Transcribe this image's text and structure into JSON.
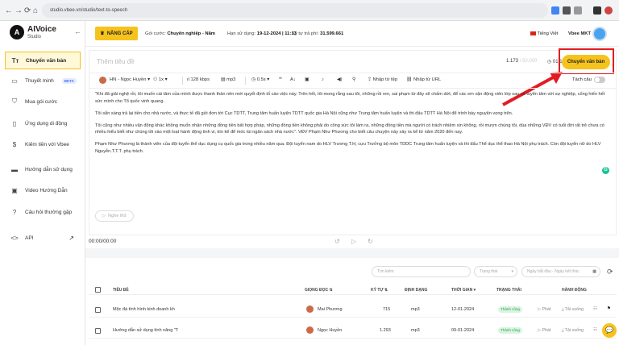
{
  "browser": {
    "url": "studio.vbee.vn/studio/text-to-speech",
    "nav": [
      "←",
      "→",
      "⟳",
      "⌂"
    ]
  },
  "brand": {
    "name": "AIVoice",
    "sub": "Studio",
    "logo_letter": "A"
  },
  "sidebar": {
    "items": [
      {
        "label": "Chuyển văn bản",
        "icon": "text-icon",
        "glyph": "Tт",
        "active": true
      },
      {
        "label": "Thuyết minh",
        "icon": "video-icon",
        "glyph": "▭",
        "beta": "BETA"
      },
      {
        "label": "Mua gói cước",
        "icon": "cart-icon",
        "glyph": "⛉"
      },
      {
        "label": "Ứng dụng di động",
        "icon": "phone-icon",
        "glyph": "▯"
      },
      {
        "label": "Kiếm tiền với Vbee",
        "icon": "dollar-icon",
        "glyph": "$"
      },
      {
        "label": "Hướng dẫn sử dụng",
        "icon": "folder-icon",
        "glyph": "▬"
      },
      {
        "label": "Video Hướng Dẫn",
        "icon": "video-guide-icon",
        "glyph": "▣"
      },
      {
        "label": "Câu hỏi thường gặp",
        "icon": "help-icon",
        "glyph": "?"
      },
      {
        "label": "API",
        "icon": "code-icon",
        "glyph": "<>",
        "external": "↗"
      }
    ]
  },
  "topbar": {
    "upgrade": "NÂNG CẤP",
    "plan_label": "Gói cước:",
    "plan_value": "Chuyên nghiệp - Năm",
    "expiry_label": "Hạn sử dụng:",
    "expiry_value": "19-12-2024 | 11:13",
    "chars_label": "Ký tự trả phí:",
    "chars_value": "31.599.661",
    "language": "Tiếng Việt",
    "user": "Vbee MKT"
  },
  "editor": {
    "title_placeholder": "Thêm tiêu đề",
    "count_used": "1.173",
    "count_max": "/ 50.000",
    "duration": "01:10",
    "convert_button": "Chuyển văn bản",
    "toolbar": {
      "voice": "HN - Ngọc Huyền",
      "speed": "1x",
      "bitrate": "128 kbps",
      "format": "mp3",
      "pause": "0.5s",
      "import_file": "Nhập từ tệp",
      "import_url": "Nhập từ URL",
      "split": "Tách câu"
    },
    "paragraphs": [
      "\"Khi đã giải nghệ rồi, tôi muốn cái tâm của mình được thanh thản nên mới quyết định tố cáo việc này. Trên hết, tôi mong rằng sau tôi, những rồi ren, sai phạm từ đây sẽ chấm dứt, để các em vận động viên lớp sau có tuyển tâm với sự nghiệp, cống hiến hết sức mình cho Tổ quốc vinh quang.",
      "Tôi sẵn sàng trả lại tiền cho nhà nước, và thực tế đã gửi đơn tới Cục TDTT, Trung tâm huấn luyện TDTT quốc gia Hà Nội cũng như Trung tâm huấn luyện và thi đấu TDTT Hà Nội để trình bày nguyện vọng trên.",
      "Tôi cũng như nhiều vận động khác không muốn nhận những đồng tiền bất hợp pháp, những đồng tiền không phải do công sức tôi làm ra, những đồng tiền mà người có trách nhiệm xin không, rồi mượn chúng tôi, dùa những VĐV có tuổi đời rất trẻ chưa có nhiều hiểu biết như chúng tôi vào một loạt hành động tinh vi, kín kẽ để móc túi ngân sách nhà nước\". VĐV Phạm Như Phương cho biết câu chuyện này xảy ra kể từ năm 2020 đến nay.",
      "Phạm Như Phương là thành viên của đội tuyển thể dục dụng cụ quốc gia trong nhiều năm qua. Đội tuyển nam do HLV Trương T.H, cựu Trưởng bộ môn TDDC Trung tâm huấn luyện và thi đấu Thể dục thể thao Hà Nội phụ trách. Còn đội tuyển nữ do HLV Nguyễn.T.T.T. phụ trách."
    ],
    "listen": "Nghe thử"
  },
  "player": {
    "time": "00:00/00:00"
  },
  "history": {
    "search_placeholder": "Tìm kiếm",
    "status_placeholder": "Trạng thái",
    "date_placeholder": "Ngày bắt đầu - Ngày kết thúc",
    "columns": [
      "TIÊU ĐỀ",
      "GIỌNG ĐỌC",
      "KÝ TỰ",
      "ĐỊNH DẠNG",
      "THỜI GIAN",
      "TRẠNG THÁI",
      "HÀNH ĐỘNG"
    ],
    "rows": [
      {
        "title": "Mộc đá tính hình kinh doanh kh",
        "voice": "Mai Phương",
        "chars": "715",
        "format": "mp3",
        "time": "12-01-2024",
        "status": "Thành công",
        "play": "Phát",
        "download": "Tải xuống"
      },
      {
        "title": "Hướng dẫn sử dụng tính năng \"T",
        "voice": "Ngọc Huyền",
        "chars": "1.293",
        "format": "mp3",
        "time": "09-01-2024",
        "status": "Thành công",
        "play": "Phát",
        "download": "Tải xuống"
      }
    ]
  },
  "colors": {
    "accent": "#f6c31d",
    "highlight": "#e31b23",
    "success": "#2f9e4f"
  }
}
